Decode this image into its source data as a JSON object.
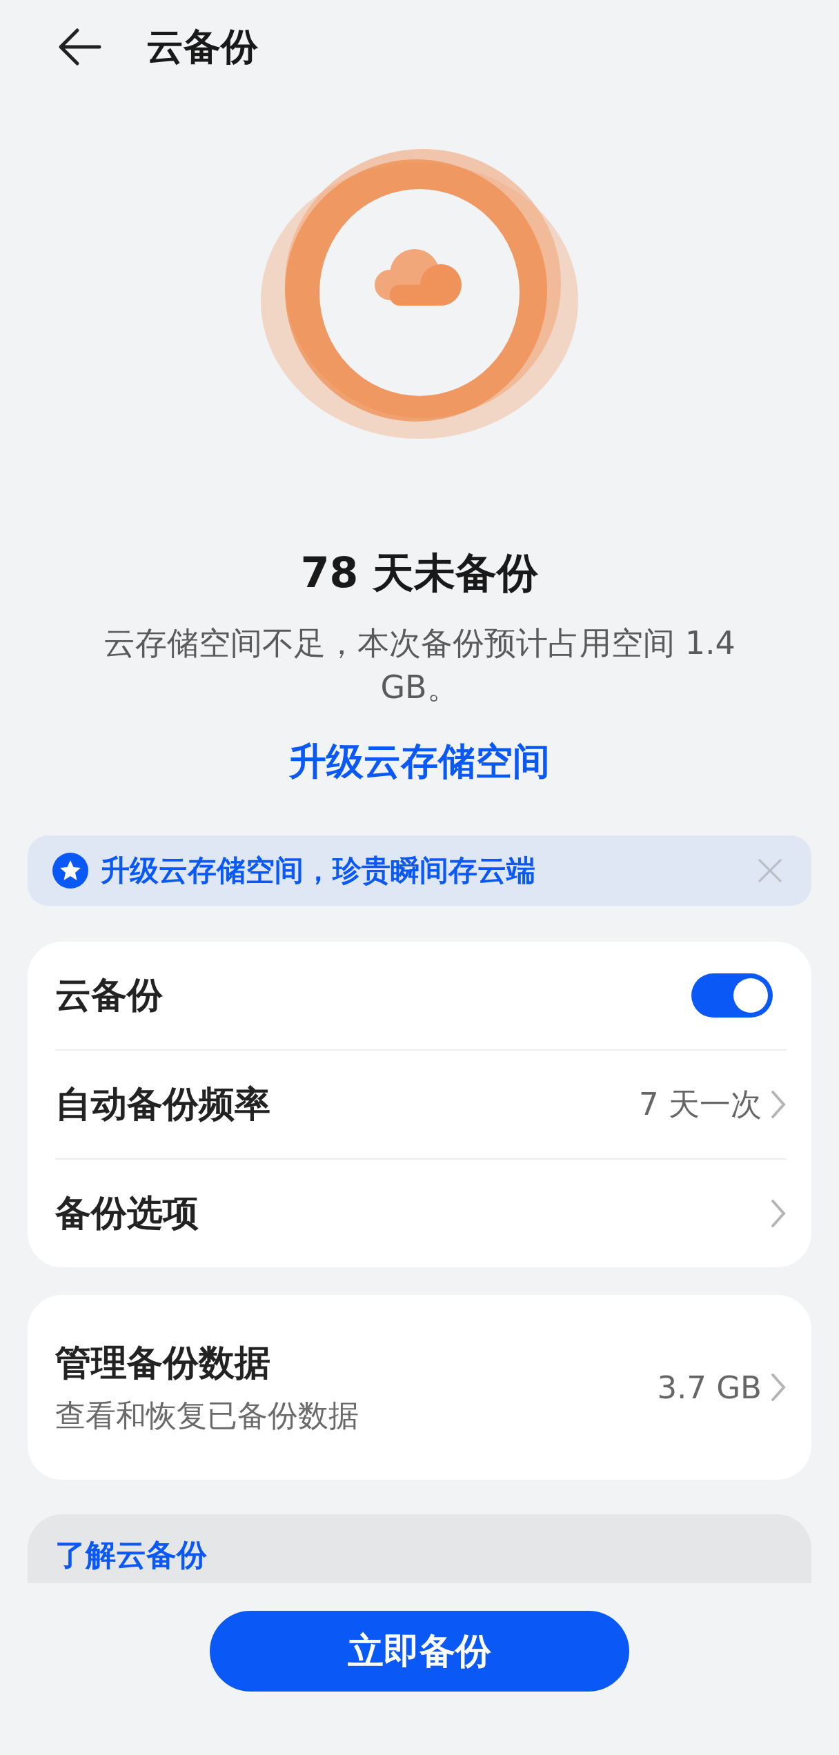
{
  "header": {
    "title": "云备份"
  },
  "status": {
    "headline": "78 天未备份",
    "description": "云存储空间不足，本次备份预计占用空间 1.4 GB。",
    "link": "升级云存储空间"
  },
  "banner": {
    "text": "升级云存储空间，珍贵瞬间存云端"
  },
  "settings": [
    {
      "kind": "toggle",
      "label": "云备份",
      "on": true
    },
    {
      "kind": "link",
      "label": "自动备份频率",
      "value": "7 天一次"
    },
    {
      "kind": "link",
      "label": "备份选项"
    }
  ],
  "data_card": {
    "title": "管理备份数据",
    "subtitle": "查看和恢复已备份数据",
    "value": "3.7 GB"
  },
  "info_card": {
    "title": "了解云备份"
  },
  "primary_button": "立即备份"
}
